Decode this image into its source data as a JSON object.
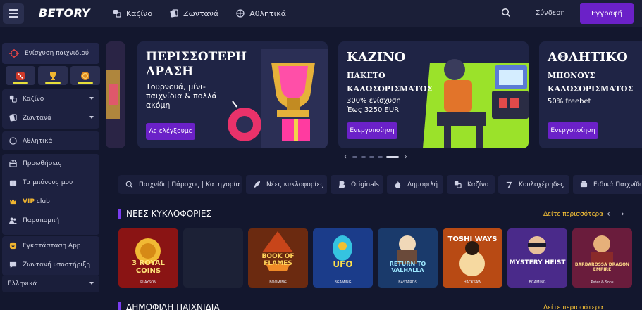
{
  "header": {
    "logo": "BETORY",
    "nav": [
      {
        "label": "Καζίνο",
        "icon": "casino-icon"
      },
      {
        "label": "Ζωντανά",
        "icon": "live-cards-icon"
      },
      {
        "label": "Αθλητικά",
        "icon": "basketball-icon"
      }
    ],
    "login_label": "Σύνδεση",
    "register_label": "Εγγραφή"
  },
  "sidebar": {
    "boost_label": "Ενίσχυση παιχνιδιού",
    "game_tiles": [
      "dice-icon",
      "trophy-icon",
      "coin-icon"
    ],
    "items": [
      {
        "label": "Καζίνο",
        "icon": "casino-icon",
        "caret": true
      },
      {
        "label": "Ζωντανά",
        "icon": "live-cards-icon",
        "caret": true
      },
      {
        "label": "Αθλητικά",
        "icon": "basketball-icon"
      },
      {
        "label": "Προωθήσεις",
        "icon": "gift-icon"
      },
      {
        "label": "Τα μπόνους μου",
        "icon": "bonus-gift-icon"
      },
      {
        "label": "VIP",
        "label2": "club",
        "icon": "crown-icon"
      },
      {
        "label": "Παραπομπή",
        "icon": "users-icon"
      },
      {
        "label": "Εγκατάσταση App",
        "icon": "app-icon"
      },
      {
        "label": "Ζωντανή υποστήριξη",
        "icon": "chat-icon"
      }
    ],
    "language": "Ελληνικά"
  },
  "banners": [
    {
      "title1": "ΠΕΡΙΣΣΟΤΕΡΗ",
      "title2": "ΔΡΑΣΗ",
      "subtitle": [
        "Τουρνουά, μίνι-",
        "παιχνίδια & πολλά",
        "ακόμη"
      ],
      "button": "Ας ελέγξουμε"
    },
    {
      "title1": "ΚΑΖΙΝΟ",
      "title2": "ΠΑΚΕΤΟ",
      "title3": "ΚΑΛΩΣΟΡΙΣΜΑΤΟΣ",
      "subtitle": [
        "300% ενίσχυση",
        "Έως 3250 EUR"
      ],
      "button": "Ενεργοποίηση"
    },
    {
      "title1": "ΑΘΛΗΤΙΚΟ",
      "title2": "ΜΠΟΝΟΥΣ",
      "title3": "ΚΑΛΩΣΟΡΙΣΜΑΤΟΣ",
      "subtitle": [
        "50% freebet"
      ],
      "button": "Ενεργοποίηση"
    }
  ],
  "categories": [
    {
      "label": "Παιχνίδι | Πάροχος | Κατηγορία",
      "icon": "search-icon"
    },
    {
      "label": "Νέες κυκλοφορίες",
      "icon": "rocket-icon"
    },
    {
      "label": "Originals",
      "icon": "originals-icon"
    },
    {
      "label": "Δημοφιλή",
      "icon": "fire-icon"
    },
    {
      "label": "Καζίνο",
      "icon": "casino-icon"
    },
    {
      "label": "Κουλοχέρηδες",
      "icon": "slot-seven-icon"
    },
    {
      "label": "Ειδικά Παιχνίδια",
      "icon": "special-icon"
    }
  ],
  "new_releases": {
    "title": "ΝΕΕΣ ΚΥΚΛΟΦΟΡΙΕΣ",
    "see_more": "Δείτε περισσότερα",
    "games": [
      {
        "name": "3 ROYAL COINS",
        "provider": "PLAYSON",
        "bg": "#8a1414"
      },
      {
        "name": "",
        "provider": "",
        "bg": "#1c2136"
      },
      {
        "name": "BOOK OF FLAMES",
        "provider": "BOOMING",
        "bg": "#6b2a10"
      },
      {
        "name": "UFO",
        "provider": "BGAMING",
        "bg": "#1b3c8a"
      },
      {
        "name": "RETURN TO VALHALLA",
        "provider": "BASTARDS",
        "bg": "#1a3a6b"
      },
      {
        "name": "TOSHI WAYS",
        "provider": "HACKSAW",
        "bg": "#b84a14"
      },
      {
        "name": "MYSTERY HEIST",
        "provider": "BGAMING",
        "bg": "#4a2a8a"
      },
      {
        "name": "BARBAROSSA DRAGON EMPIRE",
        "provider": "Peter & Sons",
        "bg": "#6a1c3c"
      }
    ]
  },
  "next_section": {
    "title": "ΔΗΜΟΦΙΛΗ ΠΑΙΧΝΙΔΙΑ",
    "see_more": "Δείτε περισσότερα"
  }
}
